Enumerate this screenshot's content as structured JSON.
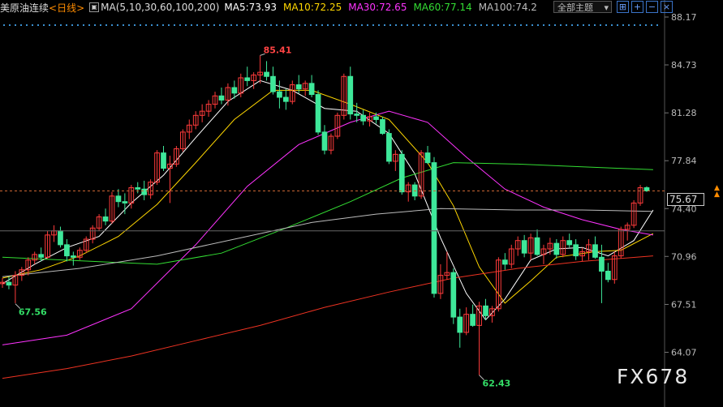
{
  "header": {
    "symbol": "美原油连续",
    "period": "<日线>",
    "ma_label": "MA(5,10,30,60,100,200)",
    "ma_values": [
      {
        "label": "MA5:73.93",
        "color": "#ffffff"
      },
      {
        "label": "MA10:72.25",
        "color": "#ffd700"
      },
      {
        "label": "MA30:72.65",
        "color": "#ff33ff"
      },
      {
        "label": "MA60:77.14",
        "color": "#33dd33"
      },
      {
        "label": "MA100:74.2",
        "color": "#bbbbbb"
      }
    ],
    "theme_button": "全部主题",
    "toolbar_icons": [
      "expand-icon",
      "plus-icon",
      "minus-icon",
      "close-icon"
    ]
  },
  "watermark": "FX678",
  "current_price_label": "75.67",
  "chart_data": {
    "type": "candlestick",
    "y_ticks": [
      "88.17",
      "84.73",
      "81.28",
      "77.84",
      "74.40",
      "70.96",
      "67.51",
      "64.07"
    ],
    "ylim": [
      62.0,
      88.17
    ],
    "current_price": 75.67,
    "annotations": [
      {
        "label": "85.41",
        "value": 85.41,
        "index": 40,
        "color": "#ff4444"
      },
      {
        "label": "67.56",
        "value": 67.56,
        "index": 2,
        "color": "#33dd66"
      },
      {
        "label": "62.43",
        "value": 62.43,
        "index": 74,
        "color": "#33dd66"
      }
    ],
    "up_color": "#ff3b3b",
    "down_color": "#3ee89a",
    "candles": [
      [
        69.0,
        69.4,
        68.7,
        69.1
      ],
      [
        69.1,
        69.5,
        68.6,
        68.9
      ],
      [
        68.9,
        69.9,
        67.6,
        69.6
      ],
      [
        69.6,
        70.2,
        69.2,
        70.0
      ],
      [
        70.0,
        70.9,
        69.6,
        70.7
      ],
      [
        70.7,
        71.3,
        70.4,
        71.1
      ],
      [
        71.1,
        71.6,
        70.6,
        70.9
      ],
      [
        70.9,
        72.8,
        70.8,
        72.5
      ],
      [
        72.5,
        73.2,
        72.0,
        72.8
      ],
      [
        72.8,
        73.1,
        71.6,
        71.8
      ],
      [
        71.8,
        72.2,
        70.6,
        71.0
      ],
      [
        71.0,
        71.3,
        70.3,
        70.9
      ],
      [
        70.9,
        71.6,
        70.7,
        71.4
      ],
      [
        71.4,
        72.4,
        71.2,
        72.2
      ],
      [
        72.2,
        73.2,
        71.9,
        73.0
      ],
      [
        73.0,
        74.0,
        72.8,
        73.8
      ],
      [
        73.8,
        74.4,
        73.2,
        73.5
      ],
      [
        73.5,
        75.6,
        73.3,
        75.3
      ],
      [
        75.3,
        75.8,
        74.5,
        74.9
      ],
      [
        74.9,
        75.5,
        74.0,
        74.8
      ],
      [
        74.8,
        76.1,
        74.4,
        75.9
      ],
      [
        75.9,
        76.3,
        75.5,
        75.8
      ],
      [
        75.8,
        76.4,
        75.0,
        75.4
      ],
      [
        75.4,
        76.5,
        75.1,
        76.3
      ],
      [
        76.3,
        78.6,
        76.1,
        78.4
      ],
      [
        78.4,
        78.9,
        77.1,
        77.3
      ],
      [
        77.3,
        78.2,
        74.8,
        77.6
      ],
      [
        77.6,
        78.9,
        77.4,
        78.7
      ],
      [
        78.7,
        80.1,
        78.5,
        79.9
      ],
      [
        79.9,
        80.8,
        79.4,
        80.4
      ],
      [
        80.4,
        81.4,
        80.1,
        81.1
      ],
      [
        81.1,
        81.9,
        80.6,
        81.4
      ],
      [
        81.4,
        82.2,
        81.0,
        81.9
      ],
      [
        81.9,
        82.8,
        81.6,
        82.5
      ],
      [
        82.5,
        83.1,
        81.9,
        82.2
      ],
      [
        82.2,
        83.4,
        81.8,
        83.1
      ],
      [
        83.1,
        83.6,
        82.3,
        82.7
      ],
      [
        82.7,
        84.1,
        82.4,
        83.8
      ],
      [
        83.8,
        84.6,
        83.2,
        83.6
      ],
      [
        83.6,
        84.2,
        83.0,
        84.0
      ],
      [
        84.0,
        85.41,
        83.4,
        84.2
      ],
      [
        84.2,
        85.0,
        83.6,
        83.9
      ],
      [
        83.9,
        84.6,
        82.6,
        82.8
      ],
      [
        82.8,
        83.6,
        81.6,
        82.4
      ],
      [
        82.4,
        83.0,
        81.5,
        82.1
      ],
      [
        82.1,
        83.6,
        81.9,
        83.3
      ],
      [
        83.3,
        84.0,
        82.7,
        83.0
      ],
      [
        83.0,
        83.6,
        82.5,
        83.4
      ],
      [
        83.4,
        84.0,
        82.4,
        82.6
      ],
      [
        82.6,
        82.9,
        79.7,
        79.9
      ],
      [
        79.9,
        80.4,
        78.3,
        78.6
      ],
      [
        78.6,
        79.8,
        78.3,
        79.6
      ],
      [
        79.6,
        81.3,
        79.4,
        81.1
      ],
      [
        81.1,
        84.1,
        80.8,
        83.9
      ],
      [
        83.9,
        84.6,
        80.8,
        81.2
      ],
      [
        81.2,
        82.0,
        80.6,
        81.1
      ],
      [
        81.1,
        81.5,
        80.4,
        80.7
      ],
      [
        80.7,
        81.3,
        80.3,
        81.0
      ],
      [
        81.0,
        81.3,
        80.5,
        80.8
      ],
      [
        80.8,
        81.0,
        79.7,
        79.8
      ],
      [
        79.8,
        80.1,
        77.6,
        77.8
      ],
      [
        77.8,
        78.6,
        77.1,
        78.3
      ],
      [
        78.3,
        78.6,
        75.4,
        75.6
      ],
      [
        75.6,
        76.3,
        74.9,
        76.1
      ],
      [
        76.1,
        76.3,
        75.0,
        75.3
      ],
      [
        75.3,
        78.6,
        75.1,
        78.4
      ],
      [
        78.4,
        78.9,
        77.6,
        77.7
      ],
      [
        77.7,
        78.1,
        68.0,
        68.3
      ],
      [
        68.3,
        70.4,
        67.9,
        69.6
      ],
      [
        69.6,
        71.3,
        69.3,
        69.8
      ],
      [
        69.8,
        70.1,
        66.1,
        66.6
      ],
      [
        66.6,
        67.2,
        64.4,
        65.5
      ],
      [
        65.5,
        67.3,
        65.3,
        66.8
      ],
      [
        66.8,
        67.5,
        65.9,
        66.0
      ],
      [
        66.0,
        67.7,
        62.43,
        67.4
      ],
      [
        67.4,
        67.9,
        66.4,
        66.7
      ],
      [
        66.7,
        67.4,
        66.2,
        67.2
      ],
      [
        67.2,
        70.9,
        67.0,
        70.7
      ],
      [
        70.7,
        71.2,
        70.0,
        70.4
      ],
      [
        70.4,
        71.8,
        70.1,
        71.5
      ],
      [
        71.5,
        72.4,
        71.0,
        72.1
      ],
      [
        72.1,
        72.5,
        70.9,
        71.2
      ],
      [
        71.2,
        72.6,
        70.7,
        72.3
      ],
      [
        72.3,
        72.9,
        71.0,
        71.1
      ],
      [
        71.1,
        71.8,
        70.4,
        71.5
      ],
      [
        71.5,
        72.3,
        71.1,
        71.9
      ],
      [
        71.9,
        72.2,
        70.8,
        71.1
      ],
      [
        71.1,
        72.4,
        70.9,
        72.1
      ],
      [
        72.1,
        72.6,
        71.6,
        71.8
      ],
      [
        71.8,
        72.2,
        70.7,
        71.0
      ],
      [
        71.0,
        71.6,
        70.6,
        71.3
      ],
      [
        71.3,
        72.2,
        70.7,
        71.8
      ],
      [
        71.8,
        72.4,
        70.8,
        70.9
      ],
      [
        70.9,
        71.8,
        67.6,
        69.9
      ],
      [
        69.9,
        70.5,
        69.1,
        69.3
      ],
      [
        69.3,
        71.3,
        69.0,
        71.0
      ],
      [
        71.0,
        73.1,
        70.8,
        72.9
      ],
      [
        72.9,
        73.4,
        72.1,
        73.2
      ],
      [
        73.2,
        75.0,
        73.0,
        74.8
      ],
      [
        74.8,
        76.1,
        74.6,
        75.9
      ],
      [
        75.9,
        76.0,
        75.6,
        75.67
      ]
    ],
    "ma_lines": [
      {
        "name": "MA5",
        "color": "#ffffff",
        "points": [
          [
            0,
            69.0
          ],
          [
            5,
            70.4
          ],
          [
            10,
            71.6
          ],
          [
            15,
            72.4
          ],
          [
            20,
            74.8
          ],
          [
            25,
            76.8
          ],
          [
            30,
            79.5
          ],
          [
            35,
            82.1
          ],
          [
            40,
            83.6
          ],
          [
            45,
            82.9
          ],
          [
            50,
            81.6
          ],
          [
            55,
            81.4
          ],
          [
            60,
            79.8
          ],
          [
            64,
            76.9
          ],
          [
            68,
            72.3
          ],
          [
            72,
            68.3
          ],
          [
            75,
            66.4
          ],
          [
            78,
            67.9
          ],
          [
            82,
            70.7
          ],
          [
            86,
            71.5
          ],
          [
            90,
            71.6
          ],
          [
            94,
            71.0
          ],
          [
            98,
            72.1
          ],
          [
            101,
            74.3
          ]
        ]
      },
      {
        "name": "MA10",
        "color": "#ffd700",
        "points": [
          [
            0,
            69.4
          ],
          [
            6,
            70.0
          ],
          [
            12,
            71.0
          ],
          [
            18,
            72.4
          ],
          [
            24,
            74.7
          ],
          [
            30,
            77.7
          ],
          [
            36,
            80.8
          ],
          [
            42,
            82.9
          ],
          [
            48,
            82.9
          ],
          [
            54,
            81.9
          ],
          [
            60,
            80.8
          ],
          [
            66,
            77.7
          ],
          [
            70,
            74.6
          ],
          [
            74,
            70.2
          ],
          [
            78,
            67.6
          ],
          [
            82,
            69.2
          ],
          [
            86,
            70.9
          ],
          [
            92,
            71.3
          ],
          [
            96,
            71.4
          ],
          [
            101,
            72.6
          ]
        ]
      },
      {
        "name": "MA30",
        "color": "#ff33ff",
        "points": [
          [
            0,
            64.6
          ],
          [
            10,
            65.3
          ],
          [
            20,
            67.2
          ],
          [
            30,
            71.8
          ],
          [
            38,
            76.0
          ],
          [
            46,
            79.0
          ],
          [
            54,
            80.6
          ],
          [
            60,
            81.4
          ],
          [
            66,
            80.6
          ],
          [
            72,
            78.1
          ],
          [
            78,
            75.8
          ],
          [
            84,
            74.5
          ],
          [
            90,
            73.6
          ],
          [
            96,
            72.9
          ],
          [
            101,
            72.5
          ]
        ]
      },
      {
        "name": "MA60",
        "color": "#33dd33",
        "points": [
          [
            0,
            70.9
          ],
          [
            14,
            70.6
          ],
          [
            24,
            70.4
          ],
          [
            34,
            71.2
          ],
          [
            44,
            73.0
          ],
          [
            54,
            74.9
          ],
          [
            62,
            76.6
          ],
          [
            70,
            77.7
          ],
          [
            80,
            77.6
          ],
          [
            90,
            77.4
          ],
          [
            101,
            77.2
          ]
        ]
      },
      {
        "name": "MA100",
        "color": "#bbbbbb",
        "points": [
          [
            0,
            69.5
          ],
          [
            12,
            70.1
          ],
          [
            24,
            71.0
          ],
          [
            36,
            72.2
          ],
          [
            48,
            73.4
          ],
          [
            58,
            74.0
          ],
          [
            68,
            74.4
          ],
          [
            80,
            74.3
          ],
          [
            90,
            74.3
          ],
          [
            101,
            74.2
          ]
        ]
      },
      {
        "name": "MA200",
        "color": "#ee3322",
        "points": [
          [
            0,
            62.2
          ],
          [
            10,
            62.9
          ],
          [
            20,
            63.8
          ],
          [
            30,
            64.9
          ],
          [
            40,
            66.0
          ],
          [
            50,
            67.3
          ],
          [
            60,
            68.4
          ],
          [
            70,
            69.4
          ],
          [
            80,
            70.1
          ],
          [
            90,
            70.6
          ],
          [
            101,
            71.0
          ]
        ]
      }
    ],
    "ref_lines": [
      {
        "value": 72.8,
        "color": "#666666"
      },
      {
        "value": 75.67,
        "color": "#cc6633",
        "dashed": true
      }
    ],
    "grid": false
  }
}
